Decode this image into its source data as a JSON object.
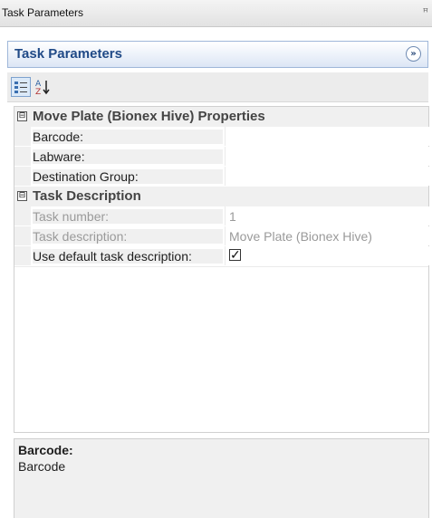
{
  "window": {
    "title": "Task Parameters",
    "pin_icon": "pin-icon"
  },
  "panel": {
    "title": "Task Parameters",
    "collapse_icon": "double-chevron-icon"
  },
  "toolbar": {
    "categorized_icon": "categorized-view-icon",
    "alphabetical_icon": "sort-az-icon"
  },
  "categories": [
    {
      "label": "Move Plate (Bionex Hive) Properties",
      "expander": "⊟",
      "properties": [
        {
          "name": "Barcode:",
          "value": ""
        },
        {
          "name": "Labware:",
          "value": ""
        },
        {
          "name": "Destination Group:",
          "value": ""
        }
      ]
    },
    {
      "label": "Task Description",
      "expander": "⊟",
      "properties": [
        {
          "name": "Task number:",
          "value": "1"
        },
        {
          "name": "Task description:",
          "value": "Move Plate (Bionex Hive)"
        },
        {
          "name": "Use default task description:",
          "checkbox": "✓"
        }
      ]
    }
  ],
  "description": {
    "title": "Barcode:",
    "text": "Barcode"
  }
}
